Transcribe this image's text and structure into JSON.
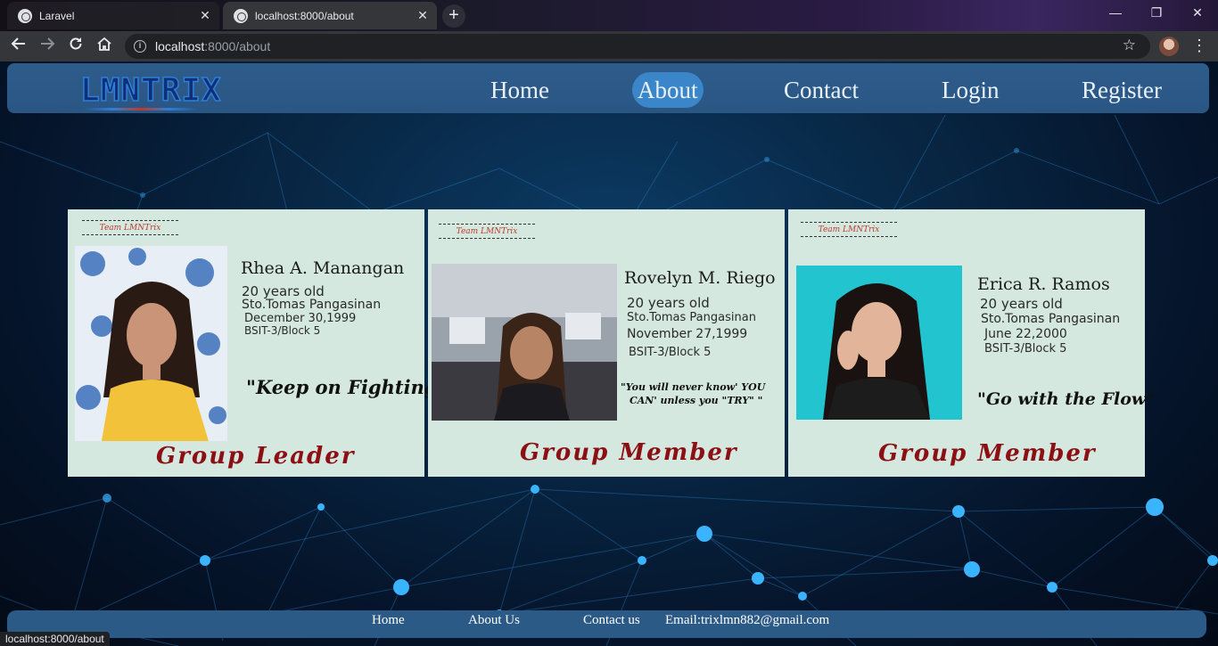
{
  "browser": {
    "tabs": [
      {
        "title": "Laravel",
        "close": "✕"
      },
      {
        "title": "localhost:8000/about",
        "close": "✕"
      }
    ],
    "new_tab": "+",
    "window_controls": {
      "minimize": "—",
      "restore": "❐",
      "close": "✕"
    },
    "url_host": "localhost",
    "url_path": ":8000/about",
    "status_url": "localhost:8000/about"
  },
  "site": {
    "logo": "LMNTRIX",
    "nav": [
      "Home",
      "About",
      "Contact",
      "Login",
      "Register"
    ],
    "active_nav": "About"
  },
  "team_badge": "Team LMNTrix",
  "members": [
    {
      "name": "Rhea A. Manangan",
      "age": "20 years old",
      "address": "Sto.Tomas Pangasinan",
      "birthday": "December 30,1999",
      "section": "BSIT-3/Block 5",
      "quote": "\"Keep on Fighting\"",
      "role": "Group Leader"
    },
    {
      "name": "Rovelyn M. Riego",
      "age": "20 years old",
      "address": "Sto.Tomas Pangasinan",
      "birthday": "November 27,1999",
      "section": "BSIT-3/Block 5",
      "quote_line1": "\"You will never know' YOU",
      "quote_line2": "CAN' unless you \"TRY\" \"",
      "role": "Group Member"
    },
    {
      "name": "Erica R. Ramos",
      "age": "20 years old",
      "address": "Sto.Tomas Pangasinan",
      "birthday": "June 22,2000",
      "section": "BSIT-3/Block 5",
      "quote": "\"Go with the Flow\"",
      "role": "Group Member"
    }
  ],
  "footer": {
    "links": [
      "Home",
      "About Us",
      "Contact us"
    ],
    "email": "Email:trixlmn882@gmail.com"
  },
  "colors": {
    "nav_bar": "#2e5c8a",
    "nav_active": "#3a86c8",
    "card_bg": "#d4e8e0",
    "role_text": "#8c0f14",
    "footer_bar": "#2c5a86"
  },
  "icons": [
    "back-icon",
    "forward-icon",
    "reload-icon",
    "home-icon",
    "info-icon",
    "star-icon",
    "profile-avatar",
    "menu-icon",
    "globe-icon"
  ]
}
